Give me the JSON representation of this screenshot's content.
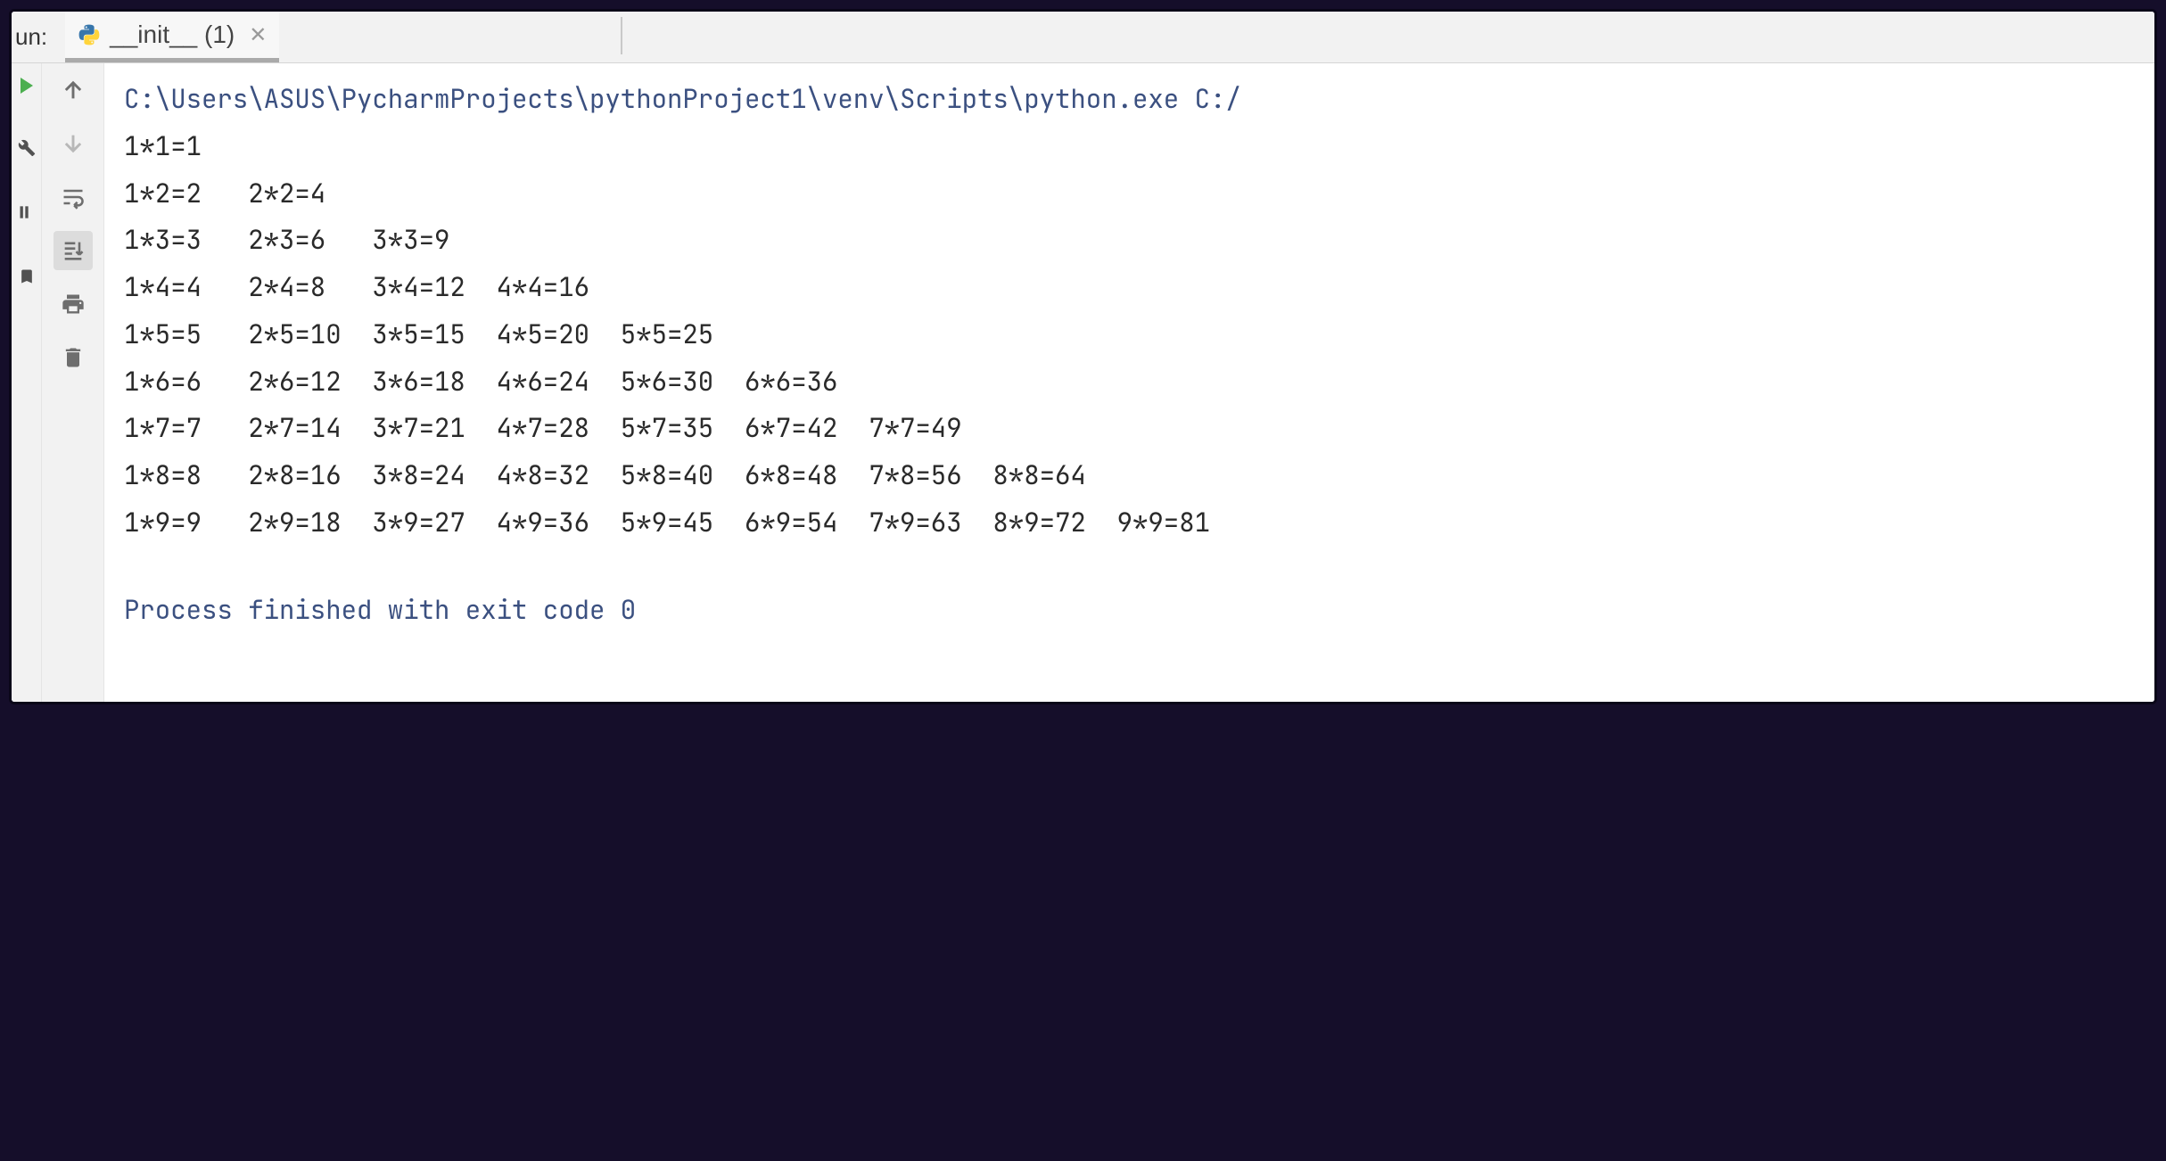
{
  "tabbar": {
    "run_label": "un:",
    "tab_label": "__init__ (1)"
  },
  "console": {
    "command": "C:\\Users\\ASUS\\PycharmProjects\\pythonProject1\\venv\\Scripts\\python.exe C:/",
    "lines": [
      "1*1=1",
      "1*2=2   2*2=4",
      "1*3=3   2*3=6   3*3=9",
      "1*4=4   2*4=8   3*4=12  4*4=16",
      "1*5=5   2*5=10  3*5=15  4*5=20  5*5=25",
      "1*6=6   2*6=12  3*6=18  4*6=24  5*6=30  6*6=36",
      "1*7=7   2*7=14  3*7=21  4*7=28  5*7=35  6*7=42  7*7=49",
      "1*8=8   2*8=16  3*8=24  4*8=32  5*8=40  6*8=48  7*8=56  8*8=64",
      "1*9=9   2*9=18  3*9=27  4*9=36  5*9=45  6*9=54  7*9=63  8*9=72  9*9=81"
    ],
    "exit_message": "Process finished with exit code 0"
  }
}
